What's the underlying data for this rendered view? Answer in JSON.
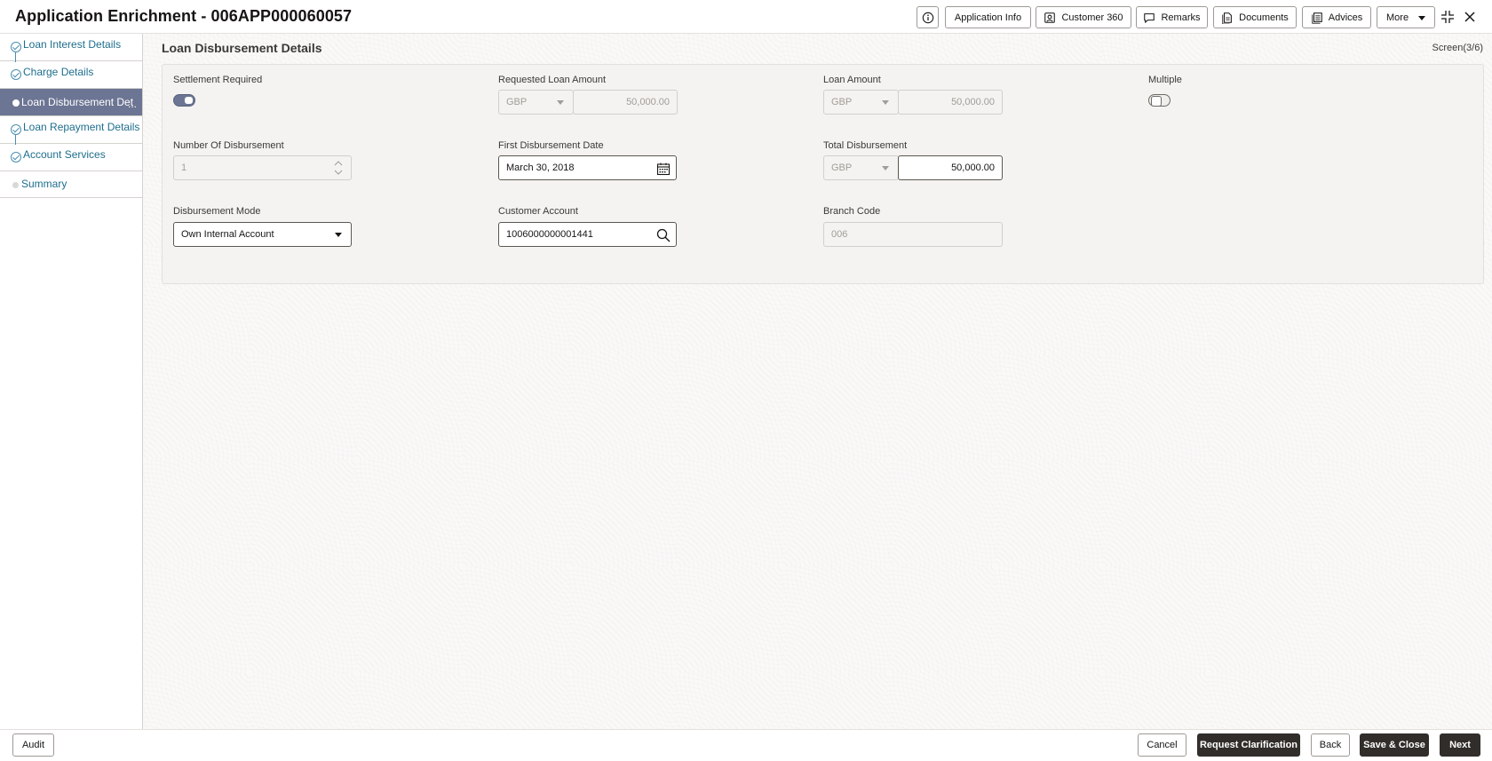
{
  "header": {
    "title": "Application Enrichment - 006APP000060057",
    "buttons": {
      "application_info": "Application Info",
      "customer_360": "Customer 360",
      "remarks": "Remarks",
      "documents": "Documents",
      "advices": "Advices",
      "more": "More"
    }
  },
  "sidebar": {
    "items": [
      {
        "label": "Loan Interest Details",
        "state": "completed"
      },
      {
        "label": "Charge Details",
        "state": "completed"
      },
      {
        "label": "Loan Disbursement Det",
        "state": "active",
        "overflow": "..."
      },
      {
        "label": "Loan Repayment Details",
        "state": "completed"
      },
      {
        "label": "Account Services",
        "state": "completed"
      },
      {
        "label": "Summary",
        "state": "pending"
      }
    ]
  },
  "main": {
    "section_title": "Loan Disbursement Details",
    "screen_indicator": "Screen(3/6)",
    "fields": {
      "settlement_required": {
        "label": "Settlement Required",
        "value": true
      },
      "requested_loan_amount": {
        "label": "Requested Loan Amount",
        "currency": "GBP",
        "amount": "50,000.00"
      },
      "loan_amount": {
        "label": "Loan Amount",
        "currency": "GBP",
        "amount": "50,000.00"
      },
      "multiple": {
        "label": "Multiple",
        "value": false
      },
      "number_of_disbursement": {
        "label": "Number Of Disbursement",
        "value": "1"
      },
      "first_disbursement_date": {
        "label": "First Disbursement Date",
        "value": "March 30, 2018"
      },
      "total_disbursement": {
        "label": "Total Disbursement",
        "currency": "GBP",
        "amount": "50,000.00"
      },
      "disbursement_mode": {
        "label": "Disbursement Mode",
        "value": "Own Internal Account"
      },
      "customer_account": {
        "label": "Customer Account",
        "value": "1006000000001441"
      },
      "branch_code": {
        "label": "Branch Code",
        "value": "006"
      }
    }
  },
  "footer": {
    "audit": "Audit",
    "cancel": "Cancel",
    "request_clarification": "Request Clarification",
    "back": "Back",
    "save_close": "Save & Close",
    "next": "Next"
  },
  "colors": {
    "accent": "#6c7593",
    "link": "#1e6e8c",
    "primary_button": "#312d2a"
  }
}
